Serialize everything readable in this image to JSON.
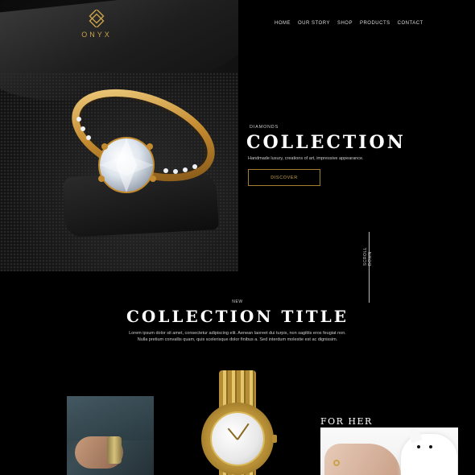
{
  "brand": {
    "name": "ONYX",
    "accent": "#c9a24a"
  },
  "nav": {
    "items": [
      "HOME",
      "OUR STORY",
      "SHOP",
      "PRODUCTS",
      "CONTACT"
    ]
  },
  "hero": {
    "eyebrow": "DIAMONDS",
    "title": "COLLECTION",
    "subtitle": "Handmade luxury, creations of art, impressive appearance.",
    "button_label": "DISCOVER",
    "scroll_label": "SCROLL DOWN"
  },
  "collection": {
    "eyebrow": "NEW",
    "title": "COLLECTION TITLE",
    "body_line1": "Lorem ipsum dolor sit amet, consectetur adipiscing elit. Aenean laoreet dui turpis, non sagittis eros feugiat non.",
    "body_line2": "Nulla pretium convallis quam, quis scelerisque dolor finibus a. Sed interdum molestie est ac dignissim."
  },
  "tiles": {
    "for_her_label": "FOR HER"
  },
  "icons": [
    "onyx-logo-icon",
    "diamond-ring-image",
    "scroll-down-indicator"
  ]
}
